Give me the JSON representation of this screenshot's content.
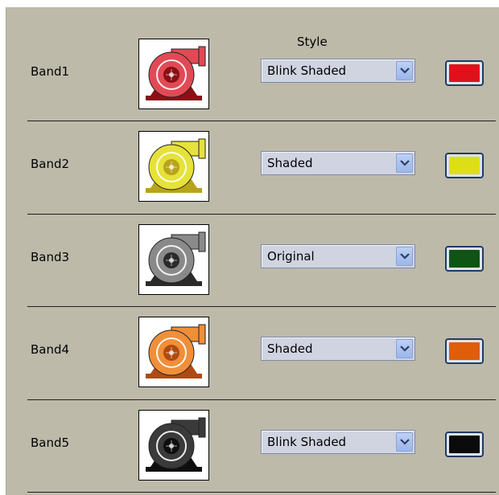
{
  "header": {
    "style_label": "Style"
  },
  "bands": [
    {
      "label": "Band1",
      "style": "Blink Shaded",
      "color": "#e0111a",
      "pump_color": "#e14a55",
      "pump_dark": "#8a1015",
      "pump_icon": "pump-icon-red"
    },
    {
      "label": "Band2",
      "style": "Shaded",
      "color": "#dede17",
      "pump_color": "#e6e23a",
      "pump_dark": "#b8a41a",
      "pump_icon": "pump-icon-yellow"
    },
    {
      "label": "Band3",
      "style": "Original",
      "color": "#0f5414",
      "pump_color": "#8a8a8a",
      "pump_dark": "#2a2a2a",
      "pump_icon": "pump-icon-gray"
    },
    {
      "label": "Band4",
      "style": "Shaded",
      "color": "#de5e0b",
      "pump_color": "#ef8f3a",
      "pump_dark": "#b04a10",
      "pump_icon": "pump-icon-orange"
    },
    {
      "label": "Band5",
      "style": "Blink Shaded",
      "color": "#0b0b0b",
      "pump_color": "#3a3a3a",
      "pump_dark": "#0e0e0e",
      "pump_icon": "pump-icon-black"
    }
  ]
}
